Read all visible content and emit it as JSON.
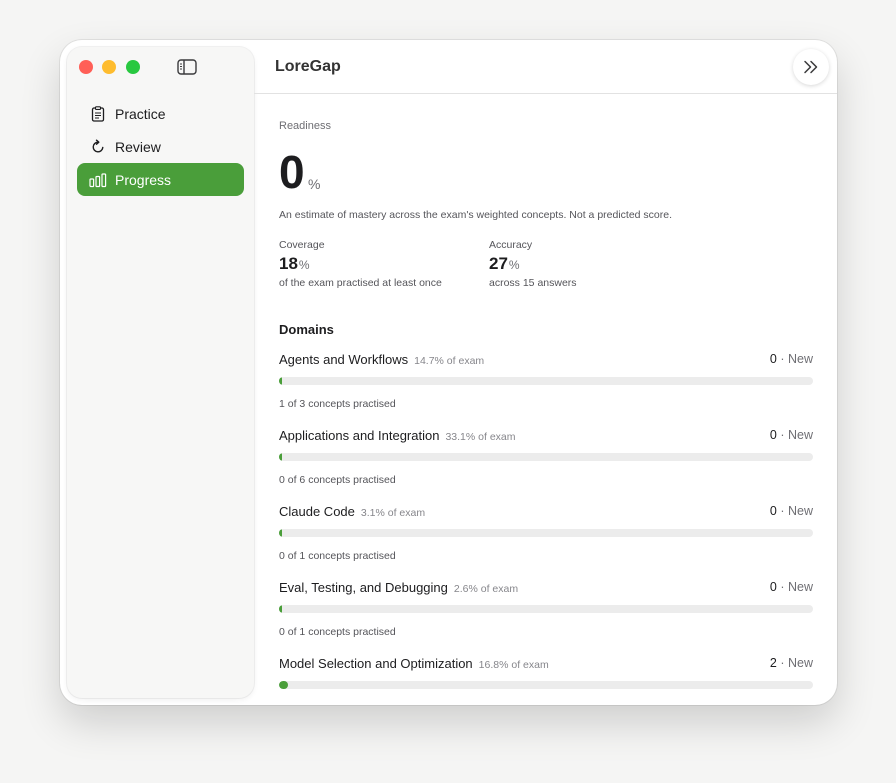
{
  "app": {
    "title": "LoreGap"
  },
  "sidebar": {
    "items": [
      {
        "label": "Practice",
        "icon": "clipboard-icon",
        "active": false
      },
      {
        "label": "Review",
        "icon": "refresh-icon",
        "active": false
      },
      {
        "label": "Progress",
        "icon": "bar-chart-icon",
        "active": true
      }
    ]
  },
  "colors": {
    "accent": "#4a9e3a",
    "track": "#ececec"
  },
  "readiness": {
    "label": "Readiness",
    "value": "0",
    "unit": "%",
    "description": "An estimate of mastery across the exam's weighted concepts. Not a predicted score."
  },
  "coverage": {
    "label": "Coverage",
    "value": "18",
    "unit": "%",
    "sub": "of the exam practised at least once"
  },
  "accuracy": {
    "label": "Accuracy",
    "value": "27",
    "unit": "%",
    "sub": "across 15 answers"
  },
  "domains": {
    "title": "Domains",
    "items": [
      {
        "name": "Agents and Workflows",
        "share": "14.7% of exam",
        "score": "0",
        "status": "· New",
        "progress": 0.006,
        "footer": "1 of 3 concepts practised"
      },
      {
        "name": "Applications and Integration",
        "share": "33.1% of exam",
        "score": "0",
        "status": "· New",
        "progress": 0.006,
        "footer": "0 of 6 concepts practised"
      },
      {
        "name": "Claude Code",
        "share": "3.1% of exam",
        "score": "0",
        "status": "· New",
        "progress": 0.006,
        "footer": "0 of 1 concepts practised"
      },
      {
        "name": "Eval, Testing, and Debugging",
        "share": "2.6% of exam",
        "score": "0",
        "status": "· New",
        "progress": 0.006,
        "footer": "0 of 1 concepts practised"
      },
      {
        "name": "Model Selection and Optimization",
        "share": "16.8% of exam",
        "score": "2",
        "status": "· New",
        "progress": 0.016,
        "footer": ""
      }
    ]
  }
}
